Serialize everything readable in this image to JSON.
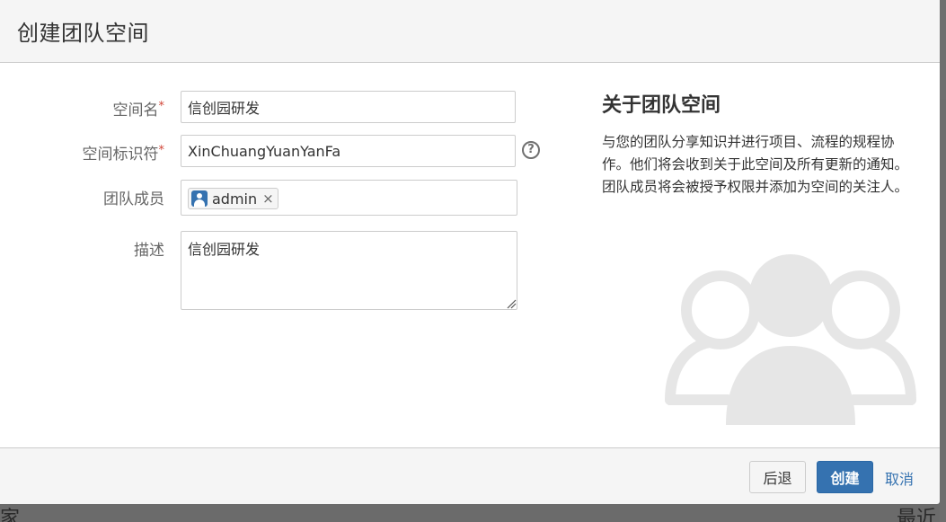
{
  "dialog": {
    "title": "创建团队空间"
  },
  "form": {
    "space_name": {
      "label": "空间名",
      "required_mark": "*",
      "value": "信创园研发"
    },
    "space_key": {
      "label": "空间标识符",
      "required_mark": "*",
      "value": "XinChuangYuanYanFa",
      "help_icon": "question-circle-icon"
    },
    "members": {
      "label": "团队成员",
      "items": [
        {
          "name": "admin",
          "icon": "user-avatar-icon",
          "remove": "×"
        }
      ]
    },
    "description": {
      "label": "描述",
      "value": "信创园研发"
    }
  },
  "about": {
    "title": "关于团队空间",
    "text": "与您的团队分享知识并进行项目、流程的规程协作。他们将会收到关于此空间及所有更新的通知。团队成员将会被授予权限并添加为空间的关注人。",
    "illustration": "team-group-icon"
  },
  "footer": {
    "back_label": "后退",
    "create_label": "创建",
    "cancel_label": "取消"
  },
  "background": {
    "bottom_left_text": "家流",
    "bottom_right_text": "最近"
  },
  "colors": {
    "primary": "#3572b0",
    "required": "#d04437",
    "illustration": "#e6e6e6"
  }
}
